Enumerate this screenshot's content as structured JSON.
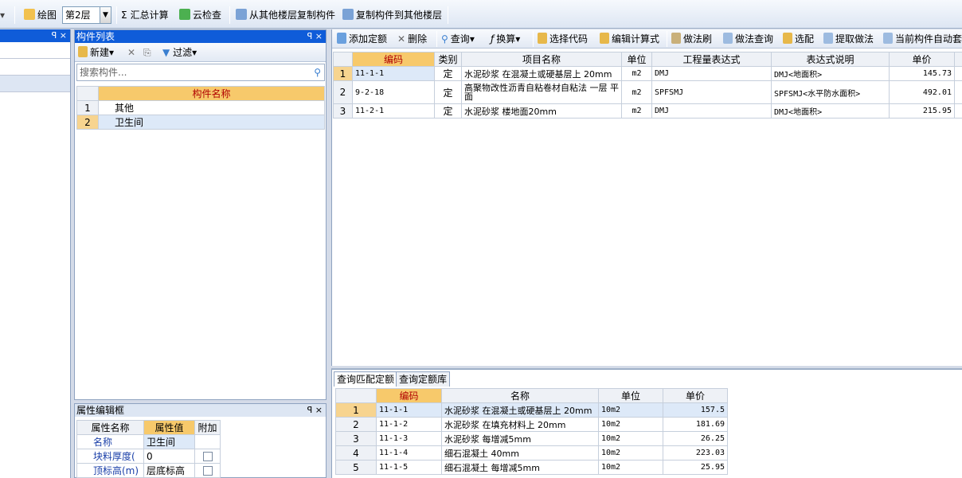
{
  "top_toolbar": {
    "draw_label": "绘图",
    "floor_value": "第2层",
    "sum_label": "汇总计算",
    "cloud_check_label": "云检查",
    "copy_from_label": "从其他楼层复制构件",
    "copy_to_label": "复制构件到其他楼层",
    "sigma_glyph": "Σ"
  },
  "component_panel": {
    "title": "构件列表",
    "new_label": "新建",
    "filter_label": "过滤",
    "search_placeholder": "搜索构件...",
    "header": "构件名称",
    "rows": [
      {
        "no": "1",
        "name": "其他"
      },
      {
        "no": "2",
        "name": "卫生间"
      }
    ]
  },
  "property_panel": {
    "title": "属性编辑框",
    "headers": {
      "name": "属性名称",
      "value": "属性值",
      "extra": "附加"
    },
    "rows": [
      {
        "name": "名称",
        "value": "卫生间"
      },
      {
        "name": "块料厚度(",
        "value": "0"
      },
      {
        "name": "顶标高(m)",
        "value": "层底标高"
      }
    ]
  },
  "main_toolbar": {
    "add_quota": "添加定额",
    "delete": "删除",
    "query": "查询",
    "convert": "换算",
    "select_code": "选择代码",
    "edit_formula": "编辑计算式",
    "method_brush": "做法刷",
    "method_query": "做法查询",
    "pick": "选配",
    "extract_method": "提取做法",
    "auto_component": "当前构件自动套"
  },
  "main_table": {
    "headers": [
      "编码",
      "类别",
      "项目名称",
      "单位",
      "工程量表达式",
      "表达式说明",
      "单价"
    ],
    "rows": [
      {
        "no": "1",
        "code": "11-1-1",
        "type": "定",
        "name": "水泥砂浆 在混凝土或硬基层上 20mm",
        "unit": "m2",
        "expr": "DMJ",
        "desc": "DMJ<地面积>",
        "price": "145.73"
      },
      {
        "no": "2",
        "code": "9-2-18",
        "type": "定",
        "name": "高聚物改性沥青自粘卷材自粘法 一层 平面",
        "unit": "m2",
        "expr": "SPFSMJ",
        "desc": "SPFSMJ<水平防水面积>",
        "price": "492.01"
      },
      {
        "no": "3",
        "code": "11-2-1",
        "type": "定",
        "name": "水泥砂浆 楼地面20mm",
        "unit": "m2",
        "expr": "DMJ",
        "desc": "DMJ<地面积>",
        "price": "215.95"
      }
    ]
  },
  "bottom_panel": {
    "tabs": [
      "查询匹配定额",
      "查询定额库"
    ],
    "headers": [
      "编码",
      "名称",
      "单位",
      "单价"
    ],
    "rows": [
      {
        "no": "1",
        "code": "11-1-1",
        "name": "水泥砂浆 在混凝土或硬基层上 20mm",
        "unit": "10m2",
        "price": "157.5"
      },
      {
        "no": "2",
        "code": "11-1-2",
        "name": "水泥砂浆 在填充材料上 20mm",
        "unit": "10m2",
        "price": "181.69"
      },
      {
        "no": "3",
        "code": "11-1-3",
        "name": "水泥砂浆 每增减5mm",
        "unit": "10m2",
        "price": "26.25"
      },
      {
        "no": "4",
        "code": "11-1-4",
        "name": "细石混凝土 40mm",
        "unit": "10m2",
        "price": "223.03"
      },
      {
        "no": "5",
        "code": "11-1-5",
        "name": "细石混凝土 每增减5mm",
        "unit": "10m2",
        "price": "25.95"
      }
    ]
  },
  "colors": {
    "title_bar": "#0f5cd9",
    "header_highlight": "#f7c96b",
    "selected_row": "#dde9f8"
  }
}
